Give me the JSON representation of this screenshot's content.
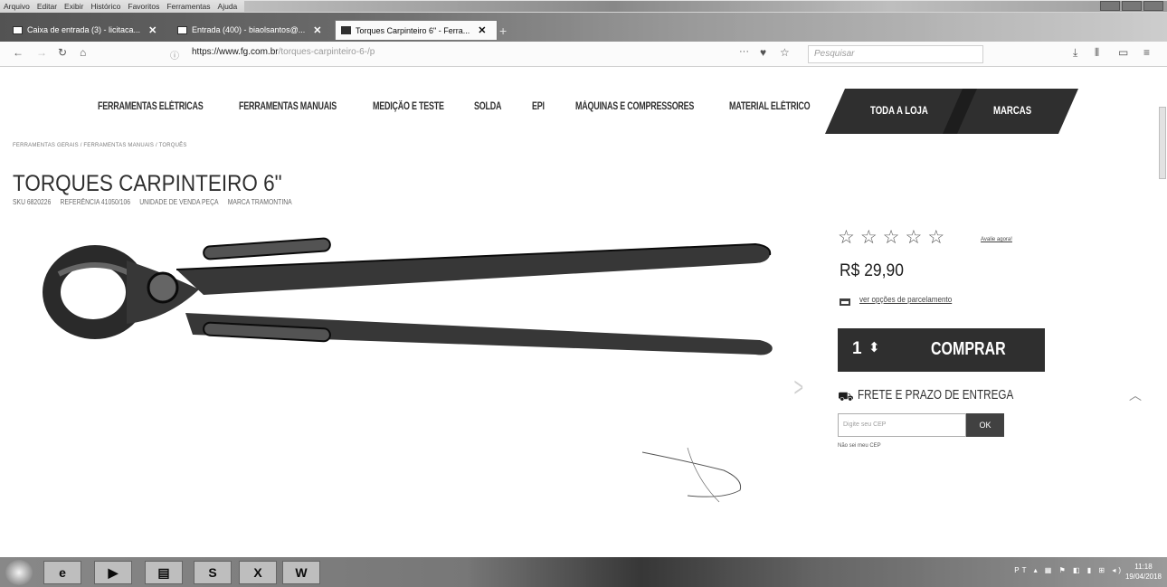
{
  "browser": {
    "menu": [
      "Arquivo",
      "Editar",
      "Exibir",
      "Histórico",
      "Favoritos",
      "Ferramentas",
      "Ajuda"
    ],
    "tabs": [
      {
        "label": "Caixa de entrada (3) - licitaca..."
      },
      {
        "label": "Entrada (400) - biaolsantos@..."
      },
      {
        "label": "Torques Carpinteiro 6\" - Ferra..."
      }
    ],
    "url_domain": "https://www.fg.com.br",
    "url_path": "/torques-carpinteiro-6-/p",
    "search_placeholder": "Pesquisar"
  },
  "site": {
    "nav": [
      "FERRAMENTAS ELÉTRICAS",
      "FERRAMENTAS MANUAIS",
      "MEDIÇÃO E TESTE",
      "SOLDA",
      "EPI",
      "MÁQUINAS E COMPRESSORES",
      "MATERIAL ELÉTRICO"
    ],
    "all_store": "TODA A LOJA",
    "brands": "MARCAS",
    "breadcrumb": "FERRAMENTAS GERAIS  /  FERRAMENTAS MANUAIS  /  TORQUÊS"
  },
  "product": {
    "title": "TORQUES CARPINTEIRO 6\"",
    "sku": "SKU 6820226",
    "reference": "REFERÊNCIA 41050/106",
    "unit": "UNIDADE DE VENDA PEÇA",
    "brand": "MARCA TRAMONTINA",
    "rate_link": "Avalie agora!",
    "rating_stars": 0,
    "price": "R$ 29,90",
    "installments": "ver opções de parcelamento",
    "quantity": "1",
    "buy_label": "COMPRAR",
    "shipping_title": "FRETE E PRAZO DE ENTREGA",
    "cep_placeholder": "Digite seu CEP",
    "ok_label": "OK",
    "no_cep": "Não sei meu CEP"
  },
  "taskbar": {
    "tray": "PT",
    "time": "11:18",
    "date": "19/04/2018"
  }
}
